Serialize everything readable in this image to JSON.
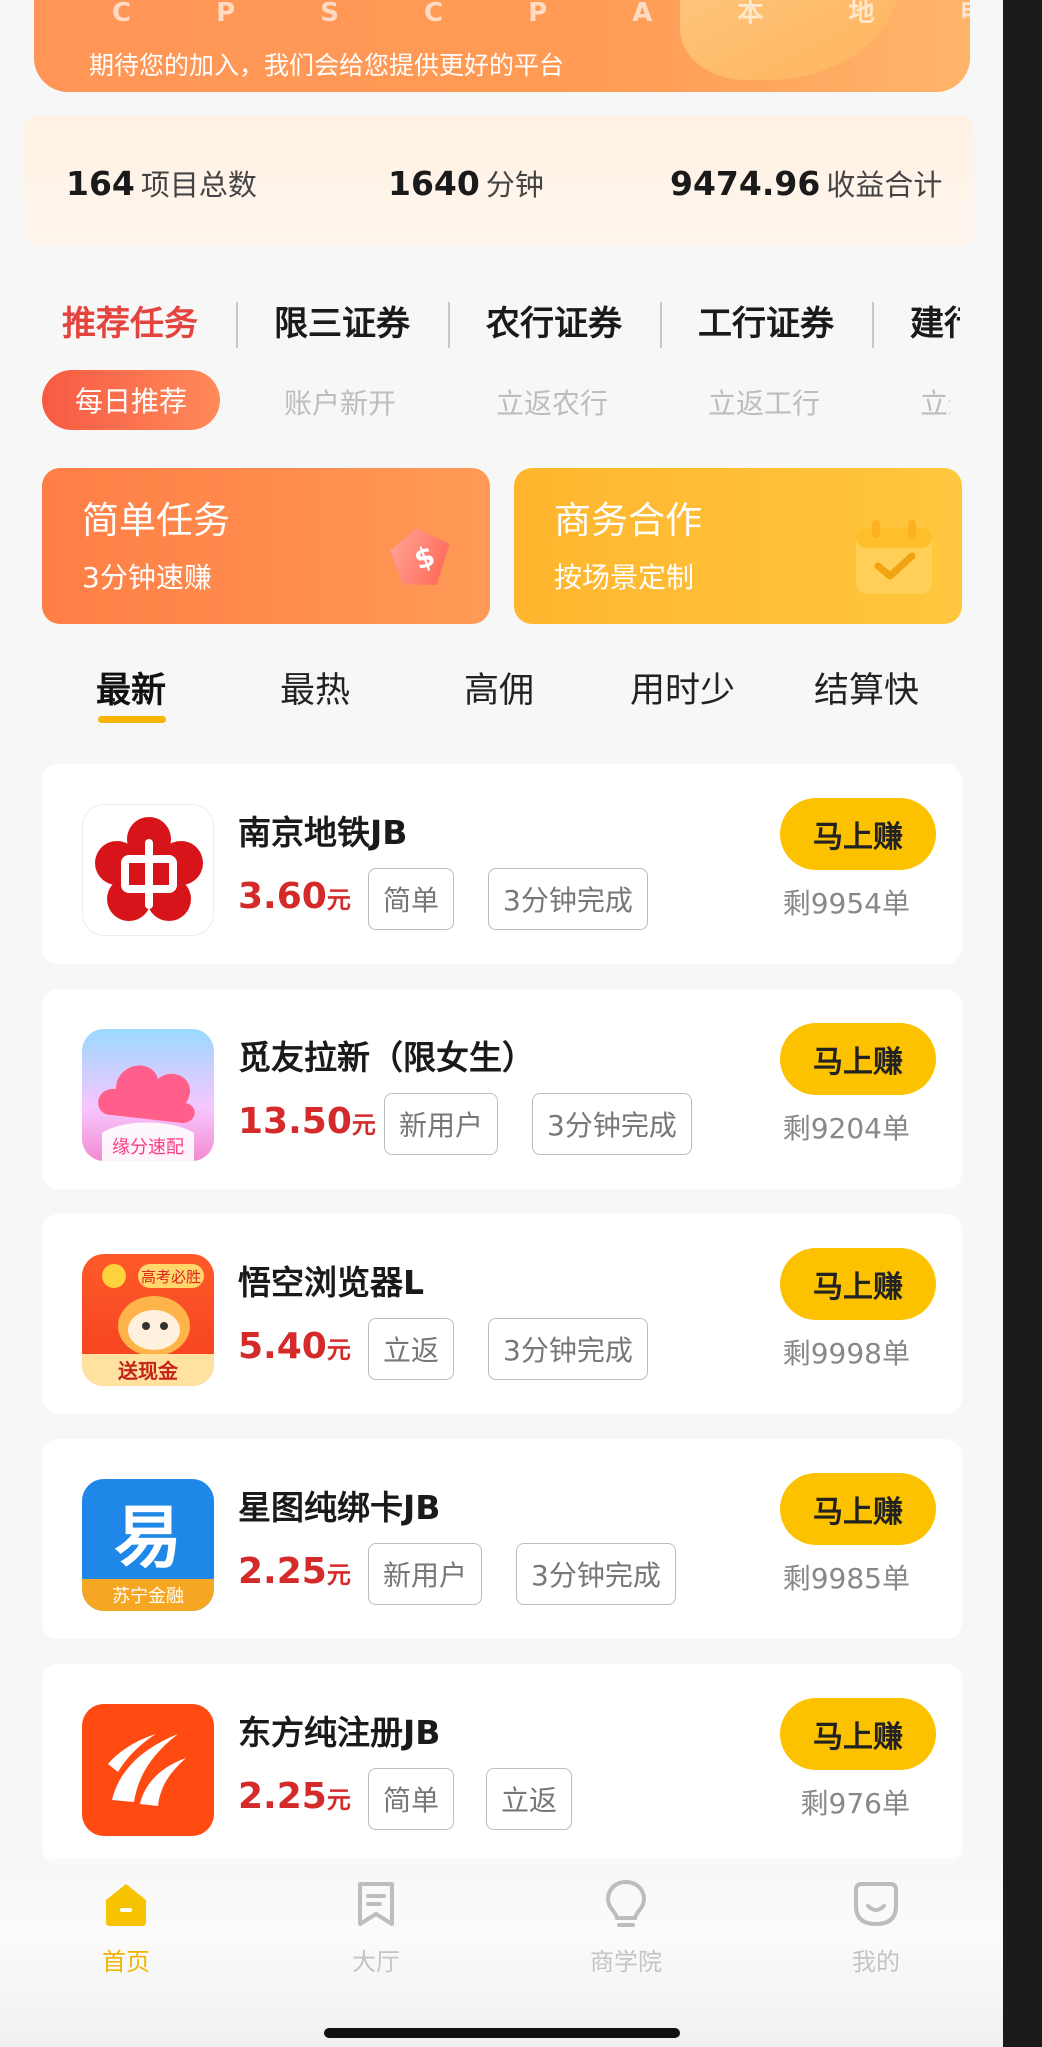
{
  "banner": {
    "tags": "C P S   C P A   本 地 电 商",
    "text": "期待您的加入，我们会给您提供更好的平台"
  },
  "stats": [
    {
      "value": "164",
      "label": "项目总数"
    },
    {
      "value": "1640",
      "label": "分钟"
    },
    {
      "value": "9474.96",
      "label": "收益合计"
    }
  ],
  "category_tabs": [
    "推荐任务",
    "限三证券",
    "农行证券",
    "工行证券",
    "建行"
  ],
  "sub_tabs": [
    "每日推荐",
    "账户新开",
    "立返农行",
    "立返工行",
    "立返"
  ],
  "promos": [
    {
      "title": "简单任务",
      "subtitle": "3分钟速赚",
      "icon": "price-tag-icon"
    },
    {
      "title": "商务合作",
      "subtitle": "按场景定制",
      "icon": "calendar-check-icon"
    }
  ],
  "sort_tabs": [
    "最新",
    "最热",
    "高佣",
    "用时少",
    "结算快"
  ],
  "tasks": [
    {
      "name": "南京地铁JB",
      "price": "3.60",
      "unit": "元",
      "tags": [
        "简单",
        "3分钟完成"
      ],
      "button": "马上赚",
      "remain": "剩9954单",
      "logo": "nanjing-metro-logo"
    },
    {
      "name": "觅友拉新（限女生）",
      "price": "13.50",
      "unit": "元",
      "tags": [
        "新用户",
        "3分钟完成"
      ],
      "button": "马上赚",
      "remain": "剩9204单",
      "logo": "yuanfen-cloud-logo",
      "logo_caption": "缘分速配"
    },
    {
      "name": "悟空浏览器L",
      "price": "5.40",
      "unit": "元",
      "tags": [
        "立返",
        "3分钟完成"
      ],
      "button": "马上赚",
      "remain": "剩9998单",
      "logo": "wukong-browser-logo",
      "logo_caption": "送现金",
      "logo_badge": "高考必胜"
    },
    {
      "name": "星图纯绑卡JB",
      "price": "2.25",
      "unit": "元",
      "tags": [
        "新用户",
        "3分钟完成"
      ],
      "button": "马上赚",
      "remain": "剩9985单",
      "logo": "suning-finance-logo",
      "logo_caption": "苏宁金融",
      "logo_glyph": "易"
    },
    {
      "name": "东方纯注册JB",
      "price": "2.25",
      "unit": "元",
      "tags": [
        "简单",
        "立返"
      ],
      "button": "马上赚",
      "remain": "剩976单",
      "logo": "eastmoney-logo"
    }
  ],
  "bottom_nav": [
    {
      "label": "首页",
      "icon": "home-icon",
      "active": true
    },
    {
      "label": "大厅",
      "icon": "bookmark-icon",
      "active": false
    },
    {
      "label": "商学院",
      "icon": "lightbulb-icon",
      "active": false
    },
    {
      "label": "我的",
      "icon": "smile-face-icon",
      "active": false
    }
  ],
  "colors": {
    "accent": "#fcc200",
    "price": "#d42a2a",
    "active_tab": "#e4443d"
  }
}
